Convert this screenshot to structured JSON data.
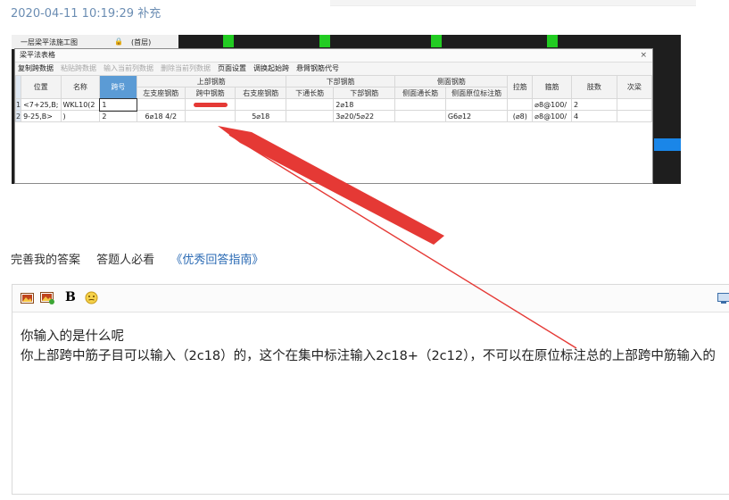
{
  "post": {
    "timestamp": "2020-04-11 10:19:29 补充"
  },
  "screenshot": {
    "strip": {
      "item1": "一层梁平法施工图",
      "lock": "🔒",
      "item2": "(首层)"
    },
    "dialog": {
      "title": "梁平法表格",
      "close": "×",
      "toolbar": [
        "复制跨数据",
        "粘贴跨数据",
        "输入当前列数据",
        "删除当前列数据",
        "页面设置",
        "调换起始跨",
        "悬臂钢筋代号"
      ],
      "toolbar_disabled": [
        false,
        true,
        true,
        true,
        false,
        false,
        false
      ],
      "group_headers": {
        "top": "上部钢筋",
        "bottom": "下部钢筋",
        "side": "侧面钢筋"
      },
      "columns": [
        "位置",
        "名称",
        "跨号",
        "左支座钢筋",
        "跨中钢筋",
        "右支座钢筋",
        "下通长筋",
        "下部钢筋",
        "侧面通长筋",
        "侧面原位标注筋",
        "拉筋",
        "箍筋",
        "肢数",
        "次梁"
      ],
      "rows": [
        {
          "num": "1",
          "pos": "<7+25,B;",
          "name": "WKL10(2",
          "span": "1",
          "left": "",
          "mid": "",
          "right": "",
          "bot_thru": "",
          "bottom": "2⌀18",
          "side_thru": "",
          "side_orig": "",
          "tie": "",
          "stirrup": "⌀8@100/",
          "legs": "2"
        },
        {
          "num": "2",
          "pos": "9-25,B>",
          "name": ")",
          "span": "2",
          "left": "6⌀18 4/2",
          "mid": "",
          "right": "5⌀18",
          "bot_thru": "",
          "bottom": "3⌀20/5⌀22",
          "side_thru": "",
          "side_orig": "G6⌀12",
          "tie": "(⌀8)",
          "stirrup": "⌀8@100/",
          "legs": "4"
        }
      ]
    }
  },
  "links": {
    "improve": "完善我的答案",
    "must_read": "答题人必看",
    "guide": "《优秀回答指南》"
  },
  "editor": {
    "toolbar": {
      "image_icon": "image-icon",
      "image2_icon": "image-upload-icon",
      "bold": "B",
      "emoji_icon": "emoji-icon"
    },
    "lines": [
      "你输入的是什么呢",
      "你上部跨中筋子目可以输入（2c18）的，这个在集中标注输入2c18+（2c12），不可以在原位标注总的上部跨中筋输入的"
    ]
  },
  "colors": {
    "arrow": "#e53935",
    "link": "#2a6ab4",
    "timestamp": "#6b8db3",
    "highlight": "#5b9bd5"
  }
}
